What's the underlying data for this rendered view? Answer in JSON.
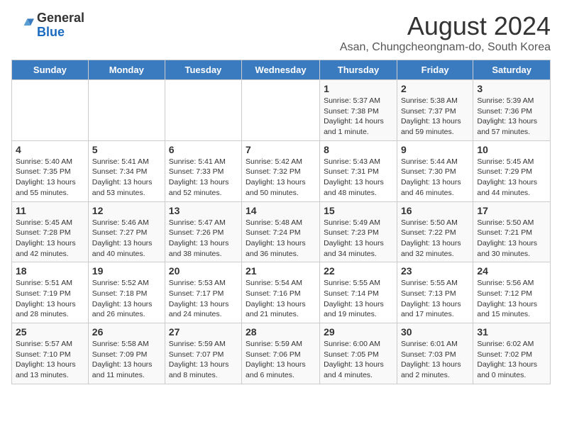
{
  "logo": {
    "general": "General",
    "blue": "Blue"
  },
  "title": "August 2024",
  "location": "Asan, Chungcheongnam-do, South Korea",
  "days_of_week": [
    "Sunday",
    "Monday",
    "Tuesday",
    "Wednesday",
    "Thursday",
    "Friday",
    "Saturday"
  ],
  "weeks": [
    [
      {
        "day": "",
        "info": ""
      },
      {
        "day": "",
        "info": ""
      },
      {
        "day": "",
        "info": ""
      },
      {
        "day": "",
        "info": ""
      },
      {
        "day": "1",
        "info": "Sunrise: 5:37 AM\nSunset: 7:38 PM\nDaylight: 14 hours\nand 1 minute."
      },
      {
        "day": "2",
        "info": "Sunrise: 5:38 AM\nSunset: 7:37 PM\nDaylight: 13 hours\nand 59 minutes."
      },
      {
        "day": "3",
        "info": "Sunrise: 5:39 AM\nSunset: 7:36 PM\nDaylight: 13 hours\nand 57 minutes."
      }
    ],
    [
      {
        "day": "4",
        "info": "Sunrise: 5:40 AM\nSunset: 7:35 PM\nDaylight: 13 hours\nand 55 minutes."
      },
      {
        "day": "5",
        "info": "Sunrise: 5:41 AM\nSunset: 7:34 PM\nDaylight: 13 hours\nand 53 minutes."
      },
      {
        "day": "6",
        "info": "Sunrise: 5:41 AM\nSunset: 7:33 PM\nDaylight: 13 hours\nand 52 minutes."
      },
      {
        "day": "7",
        "info": "Sunrise: 5:42 AM\nSunset: 7:32 PM\nDaylight: 13 hours\nand 50 minutes."
      },
      {
        "day": "8",
        "info": "Sunrise: 5:43 AM\nSunset: 7:31 PM\nDaylight: 13 hours\nand 48 minutes."
      },
      {
        "day": "9",
        "info": "Sunrise: 5:44 AM\nSunset: 7:30 PM\nDaylight: 13 hours\nand 46 minutes."
      },
      {
        "day": "10",
        "info": "Sunrise: 5:45 AM\nSunset: 7:29 PM\nDaylight: 13 hours\nand 44 minutes."
      }
    ],
    [
      {
        "day": "11",
        "info": "Sunrise: 5:45 AM\nSunset: 7:28 PM\nDaylight: 13 hours\nand 42 minutes."
      },
      {
        "day": "12",
        "info": "Sunrise: 5:46 AM\nSunset: 7:27 PM\nDaylight: 13 hours\nand 40 minutes."
      },
      {
        "day": "13",
        "info": "Sunrise: 5:47 AM\nSunset: 7:26 PM\nDaylight: 13 hours\nand 38 minutes."
      },
      {
        "day": "14",
        "info": "Sunrise: 5:48 AM\nSunset: 7:24 PM\nDaylight: 13 hours\nand 36 minutes."
      },
      {
        "day": "15",
        "info": "Sunrise: 5:49 AM\nSunset: 7:23 PM\nDaylight: 13 hours\nand 34 minutes."
      },
      {
        "day": "16",
        "info": "Sunrise: 5:50 AM\nSunset: 7:22 PM\nDaylight: 13 hours\nand 32 minutes."
      },
      {
        "day": "17",
        "info": "Sunrise: 5:50 AM\nSunset: 7:21 PM\nDaylight: 13 hours\nand 30 minutes."
      }
    ],
    [
      {
        "day": "18",
        "info": "Sunrise: 5:51 AM\nSunset: 7:19 PM\nDaylight: 13 hours\nand 28 minutes."
      },
      {
        "day": "19",
        "info": "Sunrise: 5:52 AM\nSunset: 7:18 PM\nDaylight: 13 hours\nand 26 minutes."
      },
      {
        "day": "20",
        "info": "Sunrise: 5:53 AM\nSunset: 7:17 PM\nDaylight: 13 hours\nand 24 minutes."
      },
      {
        "day": "21",
        "info": "Sunrise: 5:54 AM\nSunset: 7:16 PM\nDaylight: 13 hours\nand 21 minutes."
      },
      {
        "day": "22",
        "info": "Sunrise: 5:55 AM\nSunset: 7:14 PM\nDaylight: 13 hours\nand 19 minutes."
      },
      {
        "day": "23",
        "info": "Sunrise: 5:55 AM\nSunset: 7:13 PM\nDaylight: 13 hours\nand 17 minutes."
      },
      {
        "day": "24",
        "info": "Sunrise: 5:56 AM\nSunset: 7:12 PM\nDaylight: 13 hours\nand 15 minutes."
      }
    ],
    [
      {
        "day": "25",
        "info": "Sunrise: 5:57 AM\nSunset: 7:10 PM\nDaylight: 13 hours\nand 13 minutes."
      },
      {
        "day": "26",
        "info": "Sunrise: 5:58 AM\nSunset: 7:09 PM\nDaylight: 13 hours\nand 11 minutes."
      },
      {
        "day": "27",
        "info": "Sunrise: 5:59 AM\nSunset: 7:07 PM\nDaylight: 13 hours\nand 8 minutes."
      },
      {
        "day": "28",
        "info": "Sunrise: 5:59 AM\nSunset: 7:06 PM\nDaylight: 13 hours\nand 6 minutes."
      },
      {
        "day": "29",
        "info": "Sunrise: 6:00 AM\nSunset: 7:05 PM\nDaylight: 13 hours\nand 4 minutes."
      },
      {
        "day": "30",
        "info": "Sunrise: 6:01 AM\nSunset: 7:03 PM\nDaylight: 13 hours\nand 2 minutes."
      },
      {
        "day": "31",
        "info": "Sunrise: 6:02 AM\nSunset: 7:02 PM\nDaylight: 13 hours\nand 0 minutes."
      }
    ]
  ]
}
